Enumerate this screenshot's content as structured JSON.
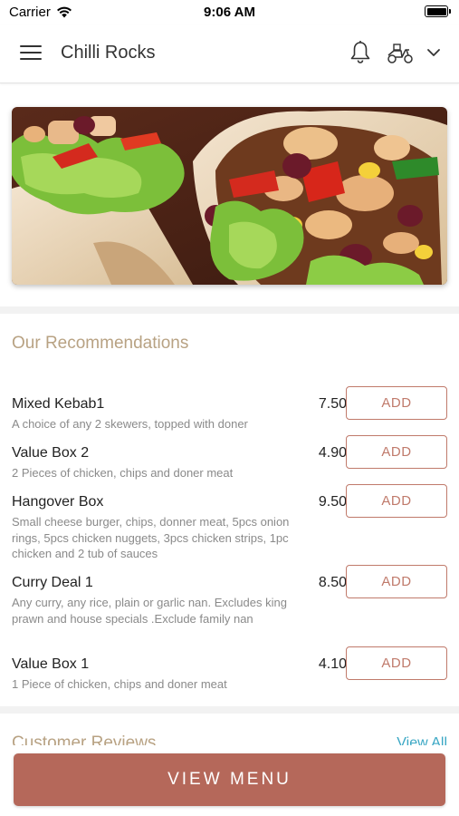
{
  "status_bar": {
    "carrier": "Carrier",
    "time": "9:06 AM"
  },
  "header": {
    "title": "Chilli Rocks"
  },
  "recommendations": {
    "title": "Our Recommendations",
    "add_label": "ADD",
    "items": [
      {
        "name": "Mixed Kebab1",
        "description": "A choice of any 2 skewers, topped with doner",
        "price": "7.50"
      },
      {
        "name": "Value Box 2",
        "description": "2 Pieces of chicken, chips and doner meat",
        "price": "4.90"
      },
      {
        "name": "Hangover Box",
        "description": "Small cheese burger, chips, donner meat, 5pcs onion rings, 5pcs chicken nuggets, 3pcs chicken strips, 1pc chicken and 2 tub of sauces",
        "price": "9.50"
      },
      {
        "name": "Curry Deal 1",
        "description": "Any curry, any rice, plain or garlic nan. Excludes king prawn and house specials .Exclude family nan",
        "price": "8.50"
      },
      {
        "name": "Value Box 1",
        "description": "1 Piece of chicken, chips and doner meat",
        "price": "4.10"
      }
    ]
  },
  "reviews": {
    "title": "Customer Reviews",
    "view_all": "View All"
  },
  "footer": {
    "view_menu": "VIEW MENU"
  },
  "colors": {
    "accent": "#b5685a",
    "section_title": "#b8a283",
    "link": "#3aa7c4"
  }
}
